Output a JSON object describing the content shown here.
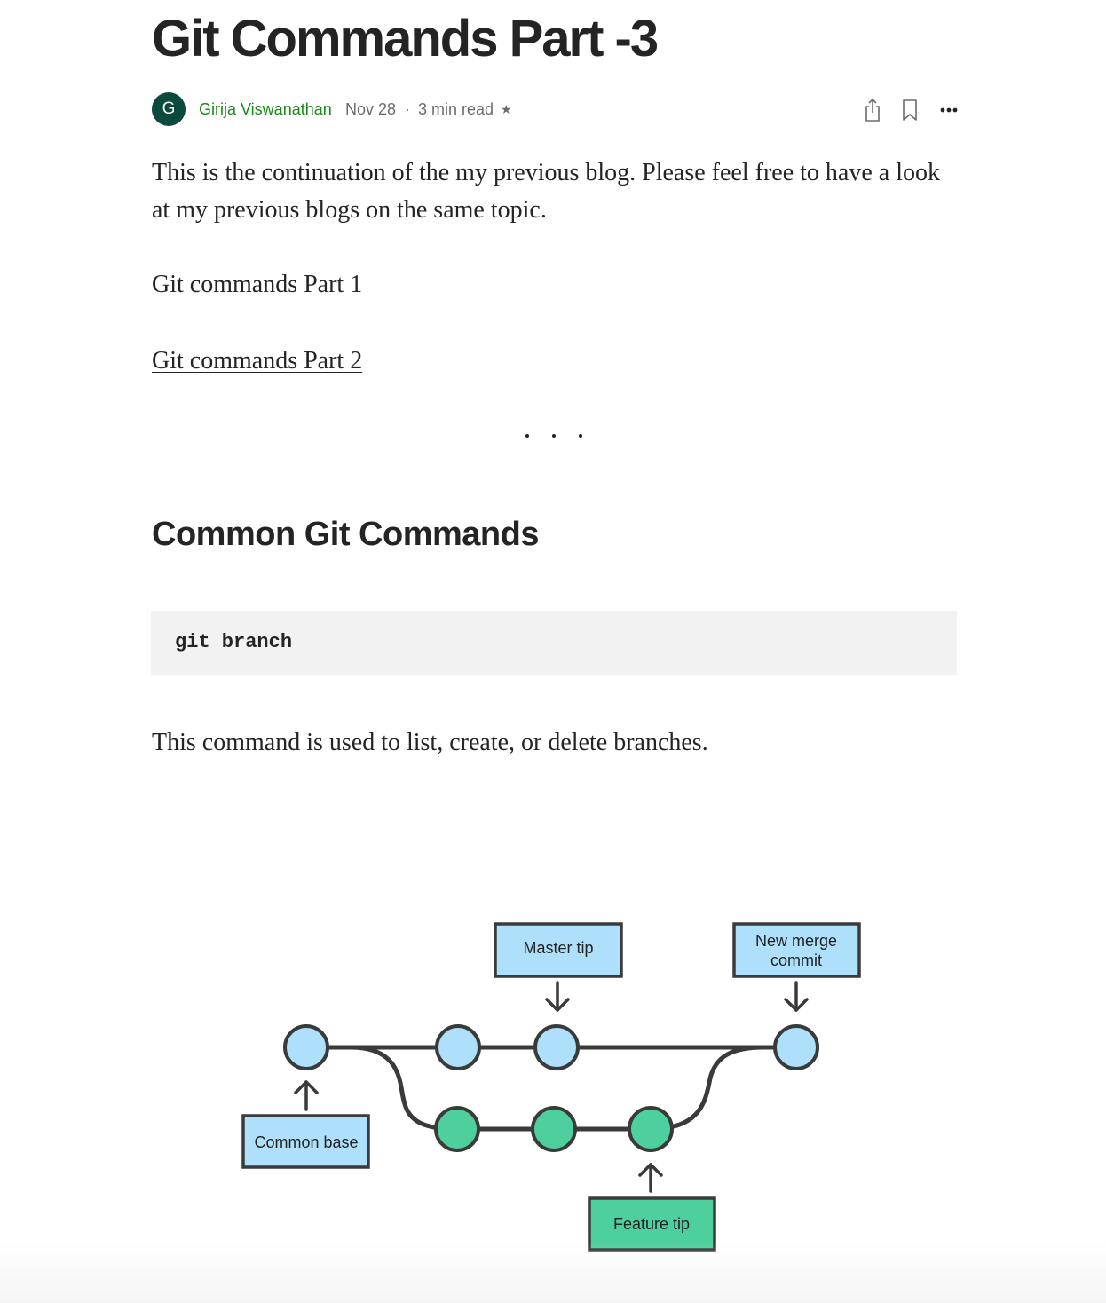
{
  "article": {
    "title": "Git Commands Part -3",
    "author": {
      "initial": "G",
      "name": "Girija Viswanathan",
      "date": "Nov 28",
      "separator": "·",
      "read_time": "3 min read",
      "star": "★"
    },
    "actions": [
      "share-icon",
      "bookmark-icon",
      "more-icon"
    ],
    "intro": "This is the continuation of the my previous blog. Please feel free to have a look at my previous blogs on the same topic.",
    "links": [
      "Git commands Part 1",
      "Git commands Part 2"
    ],
    "heading": "Common Git Commands",
    "code": "git branch",
    "description": "This command is used to list, create, or delete branches.",
    "diagram": {
      "labels": {
        "master_tip": "Master tip",
        "new_merge_commit_line1": "New merge",
        "new_merge_commit_line2": "commit",
        "common_base": "Common base",
        "feature_tip": "Feature tip"
      },
      "colors": {
        "master_commit": "#aee0fb",
        "feature_commit": "#4ecf9e",
        "line": "#3a3a3a"
      }
    }
  },
  "colors": {
    "text": "#242424",
    "author_green": "#1a8917",
    "avatar_bg": "#0b4a3c",
    "muted": "#6b6b6b",
    "code_bg": "#f2f2f2"
  }
}
